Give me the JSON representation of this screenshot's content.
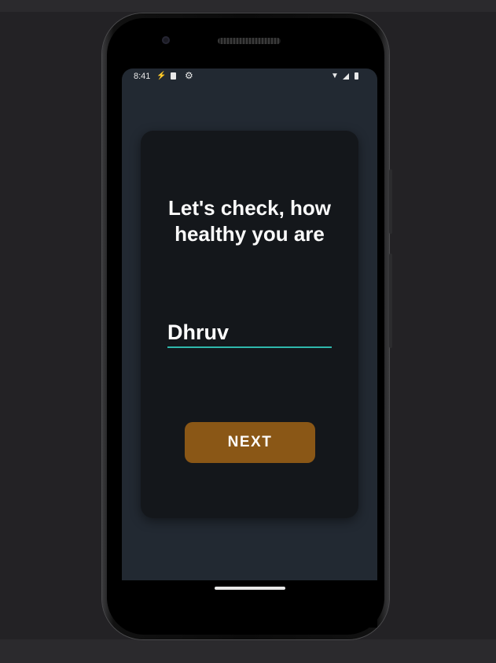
{
  "status_bar": {
    "time": "8:41",
    "icons": [
      "bolt-icon",
      "sd-card-icon",
      "gear-icon",
      "wifi-icon",
      "signal-icon",
      "battery-icon"
    ]
  },
  "card": {
    "headline": "Let's check, how healthy you are",
    "name_input": {
      "value": "Dhruv",
      "placeholder": ""
    },
    "next_label": "NEXT"
  },
  "colors": {
    "screen_bg": "#222932",
    "card_bg": "#14171b",
    "input_underline": "#2fb8ac",
    "button_bg": "#8a5716",
    "text": "#ffffff"
  }
}
